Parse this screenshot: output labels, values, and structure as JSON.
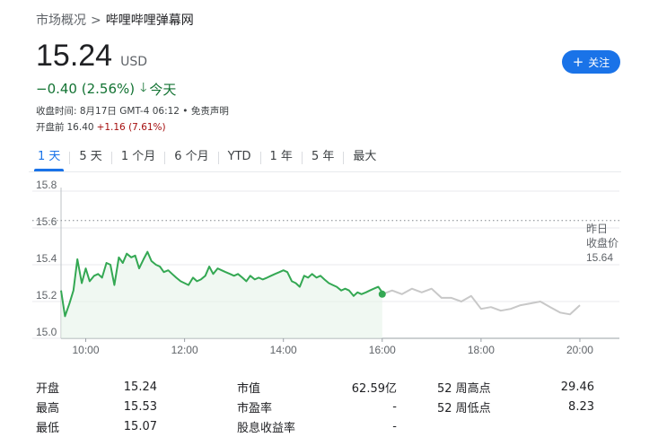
{
  "breadcrumb": {
    "root": "市场概况",
    "separator": ">",
    "current": "哔哩哔哩弹幕网"
  },
  "quote": {
    "price": "15.24",
    "currency": "USD",
    "change": "−0.40",
    "change_percent": "(2.56%)",
    "period": "今天",
    "direction_color": "#137333"
  },
  "follow_button": {
    "label": "关注",
    "color": "#1a73e8"
  },
  "meta": {
    "closed": "收盘时间: 8月17日 GMT-4 06:12 • 免责声明",
    "premarket_label": "开盘前",
    "premarket_price": "16.40",
    "premarket_change": "+1.16 (7.61%)"
  },
  "tabs": [
    {
      "label": "1 天",
      "active": true
    },
    {
      "label": "5 天",
      "active": false
    },
    {
      "label": "1 个月",
      "active": false
    },
    {
      "label": "6 个月",
      "active": false
    },
    {
      "label": "YTD",
      "active": false
    },
    {
      "label": "1 年",
      "active": false
    },
    {
      "label": "5 年",
      "active": false
    },
    {
      "label": "最大",
      "active": false
    }
  ],
  "chart_data": {
    "type": "line",
    "ylim": [
      15.0,
      15.8
    ],
    "y_ticks": [
      "15.0",
      "15.2",
      "15.4",
      "15.6",
      "15.8"
    ],
    "x_ticks": [
      "10:00",
      "12:00",
      "14:00",
      "16:00",
      "18:00",
      "20:00"
    ],
    "x_tick_values": [
      10,
      12,
      14,
      16,
      18,
      20
    ],
    "xlim": [
      9.5,
      20.8
    ],
    "previous_close": {
      "label_line1": "昨日",
      "label_line2": "收盘价",
      "value": 15.64,
      "value_label": "15.64"
    },
    "series": [
      {
        "segment": "regular",
        "color": "#34a853",
        "x": [
          9.5,
          9.58,
          9.67,
          9.75,
          9.83,
          9.92,
          10.0,
          10.08,
          10.17,
          10.25,
          10.33,
          10.42,
          10.5,
          10.58,
          10.67,
          10.75,
          10.83,
          10.92,
          11.0,
          11.08,
          11.17,
          11.25,
          11.33,
          11.42,
          11.5,
          11.58,
          11.67,
          11.75,
          11.83,
          11.92,
          12.0,
          12.08,
          12.17,
          12.25,
          12.33,
          12.42,
          12.5,
          12.58,
          12.67,
          12.75,
          12.83,
          12.92,
          13.0,
          13.08,
          13.17,
          13.25,
          13.33,
          13.42,
          13.5,
          13.58,
          13.67,
          13.75,
          13.83,
          13.92,
          14.0,
          14.08,
          14.17,
          14.25,
          14.33,
          14.42,
          14.5,
          14.58,
          14.67,
          14.75,
          14.83,
          14.92,
          15.0,
          15.08,
          15.17,
          15.25,
          15.33,
          15.42,
          15.5,
          15.58,
          15.67,
          15.75,
          15.83,
          15.92,
          16.0
        ],
        "values": [
          15.26,
          15.12,
          15.19,
          15.26,
          15.43,
          15.3,
          15.38,
          15.31,
          15.34,
          15.35,
          15.33,
          15.41,
          15.4,
          15.29,
          15.44,
          15.41,
          15.46,
          15.44,
          15.45,
          15.38,
          15.43,
          15.47,
          15.42,
          15.4,
          15.39,
          15.36,
          15.37,
          15.35,
          15.33,
          15.31,
          15.3,
          15.29,
          15.33,
          15.31,
          15.32,
          15.34,
          15.39,
          15.35,
          15.38,
          15.37,
          15.36,
          15.35,
          15.34,
          15.35,
          15.33,
          15.31,
          15.34,
          15.32,
          15.33,
          15.32,
          15.33,
          15.34,
          15.35,
          15.36,
          15.37,
          15.36,
          15.31,
          15.3,
          15.28,
          15.34,
          15.33,
          15.35,
          15.33,
          15.34,
          15.32,
          15.3,
          15.29,
          15.28,
          15.26,
          15.27,
          15.26,
          15.23,
          15.25,
          15.24,
          15.25,
          15.26,
          15.27,
          15.28,
          15.25
        ]
      },
      {
        "segment": "after-hours",
        "color": "#c8c8c8",
        "x": [
          16.0,
          16.2,
          16.4,
          16.6,
          16.8,
          17.0,
          17.2,
          17.4,
          17.6,
          17.8,
          18.0,
          18.2,
          18.4,
          18.6,
          18.8,
          19.0,
          19.2,
          19.4,
          19.6,
          19.8,
          20.0
        ],
        "values": [
          15.24,
          15.26,
          15.24,
          15.27,
          15.25,
          15.27,
          15.22,
          15.22,
          15.2,
          15.23,
          15.16,
          15.17,
          15.15,
          15.16,
          15.18,
          15.19,
          15.2,
          15.17,
          15.14,
          15.13,
          15.18
        ]
      }
    ],
    "last_point": {
      "x": 16.0,
      "y": 15.24
    }
  },
  "stats": {
    "col1": [
      {
        "label": "开盘",
        "value": "15.24"
      },
      {
        "label": "最高",
        "value": "15.53"
      },
      {
        "label": "最低",
        "value": "15.07"
      }
    ],
    "col2": [
      {
        "label": "市值",
        "value": "62.59亿"
      },
      {
        "label": "市盈率",
        "value": "-"
      },
      {
        "label": "股息收益率",
        "value": "-"
      }
    ],
    "col3": [
      {
        "label": "52 周高点",
        "value": "29.46"
      },
      {
        "label": "52 周低点",
        "value": "8.23"
      }
    ]
  }
}
